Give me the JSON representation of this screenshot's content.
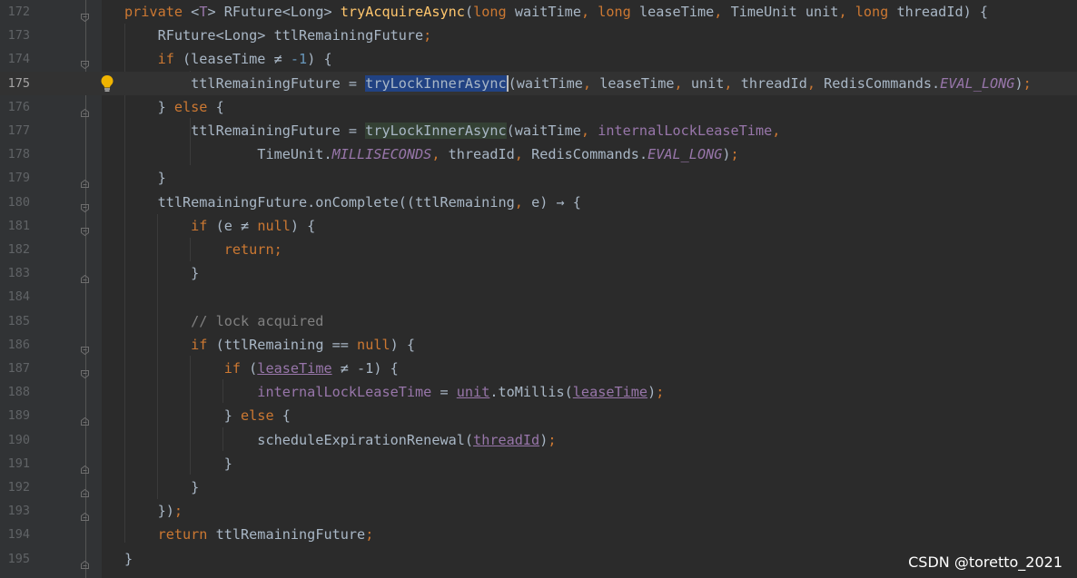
{
  "editor": {
    "lines": [
      {
        "n": "172",
        "fold": "minus",
        "segs": [
          [
            "kw",
            "private "
          ],
          [
            "",
            "<"
          ],
          [
            "fld",
            "T"
          ],
          [
            "",
            "> RFuture<Long> "
          ],
          [
            "fn",
            "tryAcquireAsync"
          ],
          [
            "",
            "("
          ],
          [
            "kw",
            "long "
          ],
          [
            "",
            "waitTime"
          ],
          [
            "kw",
            ", long "
          ],
          [
            "",
            "leaseTime"
          ],
          [
            "kw",
            ", "
          ],
          [
            "",
            "TimeUnit unit"
          ],
          [
            "kw",
            ", long "
          ],
          [
            "",
            "threadId) {"
          ]
        ]
      },
      {
        "n": "173",
        "segs": [
          [
            "",
            "    RFuture<Long> ttlRemainingFuture"
          ],
          [
            "kw",
            ";"
          ]
        ]
      },
      {
        "n": "174",
        "fold": "minus",
        "segs": [
          [
            "kw",
            "    if "
          ],
          [
            "",
            "(leaseTime ≠ "
          ],
          [
            "num",
            "-1"
          ],
          [
            "",
            ") {"
          ]
        ]
      },
      {
        "n": "175",
        "current": true,
        "bulb": true,
        "segs": [
          [
            "",
            "        ttlRemainingFuture = "
          ],
          [
            "sel",
            "tryLockInnerAsync"
          ],
          [
            "caret",
            ""
          ],
          [
            "",
            "(waitTime"
          ],
          [
            "kw",
            ", "
          ],
          [
            "",
            "leaseTime"
          ],
          [
            "kw",
            ", "
          ],
          [
            "",
            "unit"
          ],
          [
            "kw",
            ", "
          ],
          [
            "",
            "threadId"
          ],
          [
            "kw",
            ", "
          ],
          [
            "",
            "RedisCommands."
          ],
          [
            "ist",
            "EVAL_LONG"
          ],
          [
            "",
            ")"
          ],
          [
            "kw",
            ";"
          ]
        ]
      },
      {
        "n": "176",
        "fold": "end",
        "segs": [
          [
            "",
            "    } "
          ],
          [
            "kw",
            "else "
          ],
          [
            "",
            "{"
          ]
        ]
      },
      {
        "n": "177",
        "segs": [
          [
            "",
            "        ttlRemainingFuture = "
          ],
          [
            "hl",
            "tryLockInnerAsync"
          ],
          [
            "",
            "(waitTime"
          ],
          [
            "kw",
            ", "
          ],
          [
            "fld",
            "internalLockLeaseTime"
          ],
          [
            "kw",
            ","
          ]
        ]
      },
      {
        "n": "178",
        "segs": [
          [
            "",
            "                TimeUnit."
          ],
          [
            "ist",
            "MILLISECONDS"
          ],
          [
            "kw",
            ", "
          ],
          [
            "",
            "threadId"
          ],
          [
            "kw",
            ", "
          ],
          [
            "",
            "RedisCommands."
          ],
          [
            "ist",
            "EVAL_LONG"
          ],
          [
            "",
            ")"
          ],
          [
            "kw",
            ";"
          ]
        ]
      },
      {
        "n": "179",
        "fold": "end",
        "segs": [
          [
            "",
            "    }"
          ]
        ]
      },
      {
        "n": "180",
        "fold": "minus",
        "segs": [
          [
            "",
            "    ttlRemainingFuture.onComplete((ttlRemaining"
          ],
          [
            "kw",
            ", "
          ],
          [
            "",
            "e) → {"
          ]
        ]
      },
      {
        "n": "181",
        "fold": "minus",
        "segs": [
          [
            "kw",
            "        if "
          ],
          [
            "",
            "(e ≠ "
          ],
          [
            "kw",
            "null"
          ],
          [
            "",
            ") {"
          ]
        ]
      },
      {
        "n": "182",
        "segs": [
          [
            "kw",
            "            return;"
          ]
        ]
      },
      {
        "n": "183",
        "fold": "end",
        "segs": [
          [
            "",
            "        }"
          ]
        ]
      },
      {
        "n": "184",
        "segs": []
      },
      {
        "n": "185",
        "segs": [
          [
            "cm",
            "        // lock acquired"
          ]
        ]
      },
      {
        "n": "186",
        "fold": "minus",
        "segs": [
          [
            "kw",
            "        if "
          ],
          [
            "",
            "(ttlRemaining == "
          ],
          [
            "kw",
            "null"
          ],
          [
            "",
            ") {"
          ]
        ]
      },
      {
        "n": "187",
        "fold": "minus",
        "segs": [
          [
            "kw",
            "            if "
          ],
          [
            "",
            "("
          ],
          [
            "par",
            "leaseTime"
          ],
          [
            "",
            " ≠ -1) {"
          ]
        ]
      },
      {
        "n": "188",
        "segs": [
          [
            "fld",
            "                internalLockLeaseTime"
          ],
          [
            "",
            " = "
          ],
          [
            "par",
            "unit"
          ],
          [
            "",
            ".toMillis("
          ],
          [
            "par",
            "leaseTime"
          ],
          [
            "",
            ")"
          ],
          [
            "kw",
            ";"
          ]
        ]
      },
      {
        "n": "189",
        "fold": "end",
        "segs": [
          [
            "",
            "            } "
          ],
          [
            "kw",
            "else "
          ],
          [
            "",
            "{"
          ]
        ]
      },
      {
        "n": "190",
        "segs": [
          [
            "",
            "                scheduleExpirationRenewal("
          ],
          [
            "par",
            "threadId"
          ],
          [
            "",
            ")"
          ],
          [
            "kw",
            ";"
          ]
        ]
      },
      {
        "n": "191",
        "fold": "end",
        "segs": [
          [
            "",
            "            }"
          ]
        ]
      },
      {
        "n": "192",
        "fold": "end",
        "segs": [
          [
            "",
            "        }"
          ]
        ]
      },
      {
        "n": "193",
        "fold": "end",
        "segs": [
          [
            "",
            "    })"
          ],
          [
            "kw",
            ";"
          ]
        ]
      },
      {
        "n": "194",
        "segs": [
          [
            "kw",
            "    return "
          ],
          [
            "",
            "ttlRemainingFuture"
          ],
          [
            "kw",
            ";"
          ]
        ]
      },
      {
        "n": "195",
        "fold": "end",
        "segs": [
          [
            "",
            "}"
          ]
        ]
      }
    ]
  },
  "watermark": "CSDN @toretto_2021"
}
